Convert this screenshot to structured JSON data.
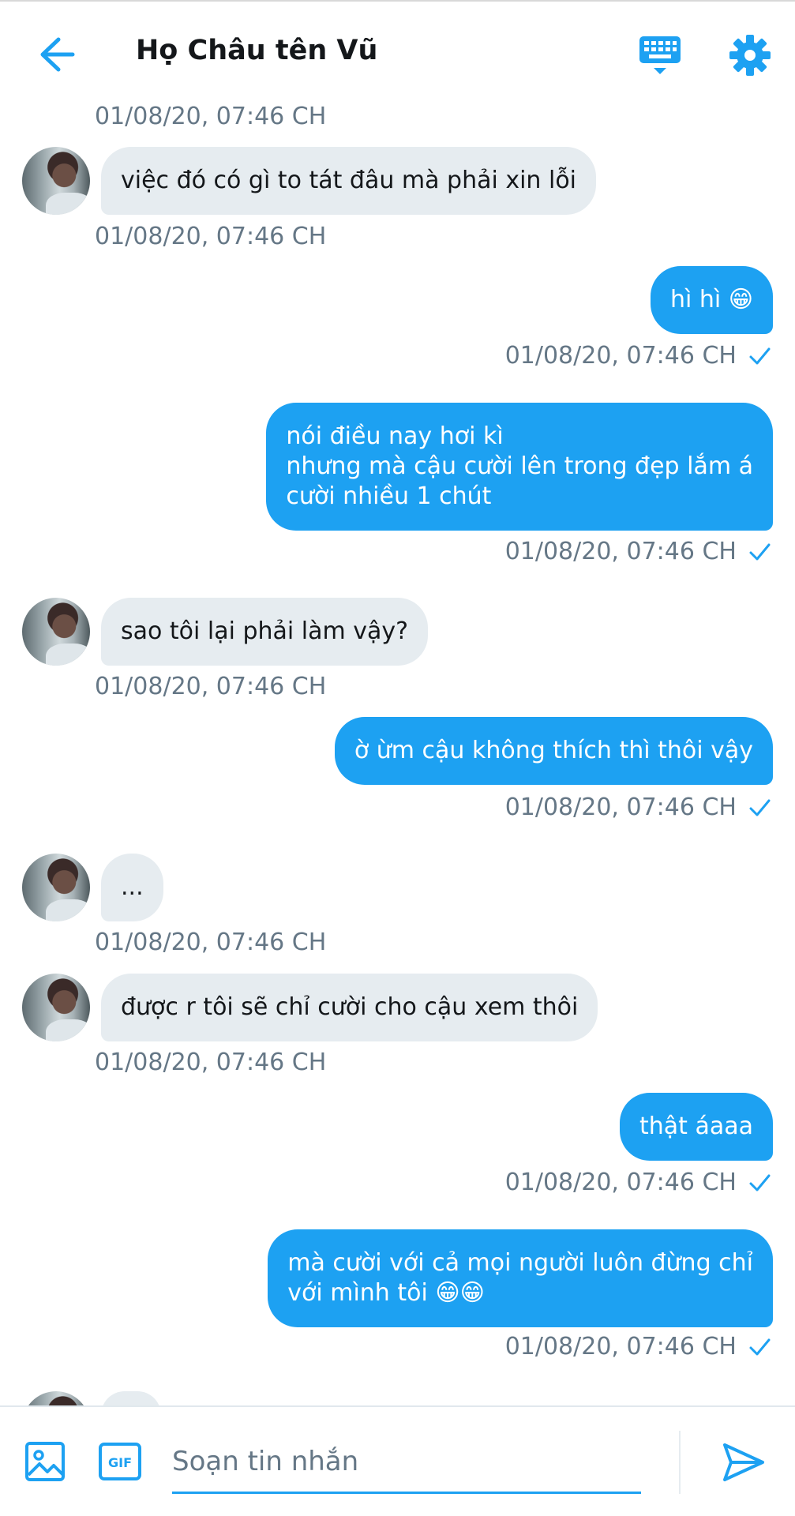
{
  "header": {
    "title": "Họ Châu tên Vũ",
    "back_icon": "arrow-left-icon",
    "keyboard_icon": "keyboard-icon",
    "settings_icon": "gear-icon"
  },
  "colors": {
    "accent": "#1da1f2",
    "incoming_bubble": "#e6ecf0",
    "timestamp": "#657786"
  },
  "messages": [
    {
      "from": "peer",
      "text": "",
      "timestamp": "01/08/20, 07:46 CH"
    },
    {
      "from": "peer",
      "text": "việc đó có gì to tát đâu mà phải xin lỗi",
      "timestamp": "01/08/20, 07:46 CH"
    },
    {
      "from": "me",
      "text": "hì hì 😁",
      "timestamp": "01/08/20, 07:46 CH",
      "read": true
    },
    {
      "from": "me",
      "text": "nói điều nay hơi kì\nnhưng mà cậu cười lên trong đẹp lắm á\ncười nhiều 1 chút",
      "timestamp": "01/08/20, 07:46 CH",
      "read": true
    },
    {
      "from": "peer",
      "text": "sao tôi lại phải làm vậy?",
      "timestamp": "01/08/20, 07:46 CH"
    },
    {
      "from": "me",
      "text": "ờ ừm cậu không thích thì thôi vậy",
      "timestamp": "01/08/20, 07:46 CH",
      "read": true
    },
    {
      "from": "peer",
      "text": "...",
      "timestamp": "01/08/20, 07:46 CH"
    },
    {
      "from": "peer",
      "text": "được r tôi sẽ chỉ cười cho cậu xem thôi",
      "timestamp": "01/08/20, 07:46 CH"
    },
    {
      "from": "me",
      "text": "thật áaaa",
      "timestamp": "01/08/20, 07:46 CH",
      "read": true
    },
    {
      "from": "me",
      "text": "mà cười với cả mọi người luôn đừng chỉ\nvới mình tôi 😁😁",
      "timestamp": "01/08/20, 07:46 CH",
      "read": true
    }
  ],
  "composer": {
    "placeholder": "Soạn tin nhắn",
    "image_icon": "image-icon",
    "gif_icon": "gif-icon",
    "gif_label": "GIF",
    "send_icon": "send-icon"
  }
}
